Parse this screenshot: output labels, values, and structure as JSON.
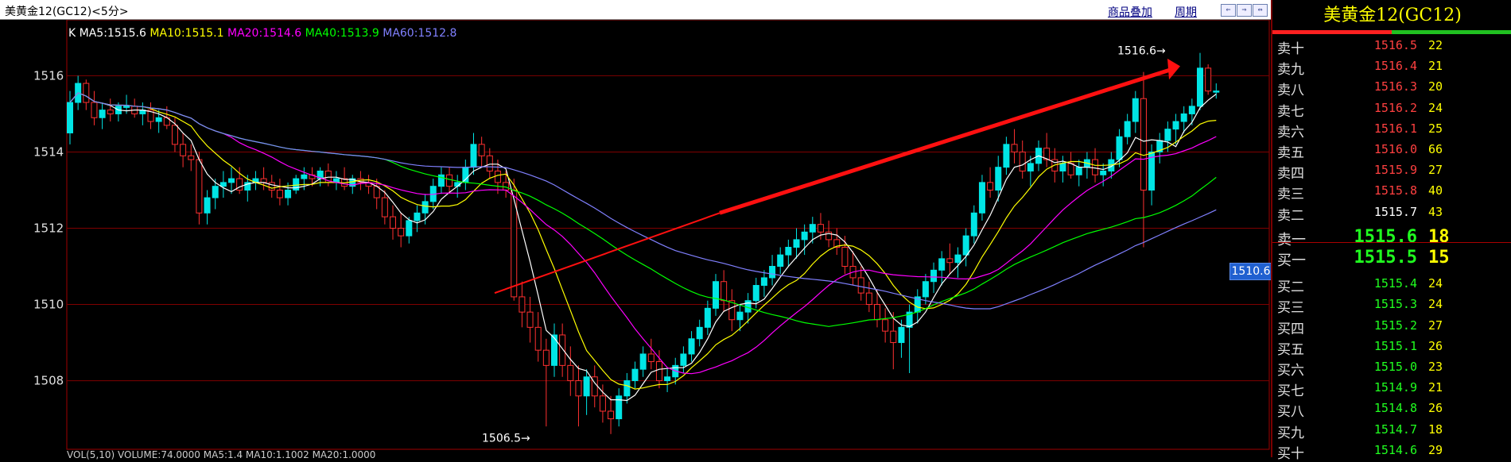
{
  "window": {
    "title": "美黄金12(GC12)<5分>",
    "overlay_link": "商品叠加",
    "period_link": "周期",
    "nav_buttons": [
      "⇐",
      "⇒",
      "⇔"
    ]
  },
  "indicator": {
    "prefix": "K",
    "items": [
      {
        "label": "MA5:1515.6",
        "color": "#ffffff"
      },
      {
        "label": "MA10:1515.1",
        "color": "#ffff00"
      },
      {
        "label": "MA20:1514.6",
        "color": "#ff00ff"
      },
      {
        "label": "MA40:1513.9",
        "color": "#00ff00"
      },
      {
        "label": "MA60:1512.8",
        "color": "#8080ff"
      }
    ]
  },
  "annotations": {
    "high_label": "1516.6",
    "low_label": "1506.5",
    "price_tag": "1510.6"
  },
  "bottom_indicator": "VOL(5,10) VOLUME:74.0000 MA5:1.4 MA10:1.1002 MA20:1.0000",
  "chart_data": {
    "type": "candlestick",
    "ylim": [
      1506.2,
      1517.3
    ],
    "y_ticks": [
      "1516",
      "1514",
      "1512",
      "1510",
      "1508"
    ],
    "candle_count": 142,
    "ohlc": [
      [
        1514.5,
        1515.6,
        1514.2,
        1515.3
      ],
      [
        1515.3,
        1516.0,
        1515.1,
        1515.8
      ],
      [
        1515.8,
        1515.9,
        1515.1,
        1515.3
      ],
      [
        1515.3,
        1515.6,
        1514.7,
        1514.9
      ],
      [
        1514.9,
        1515.3,
        1514.6,
        1515.1
      ],
      [
        1515.1,
        1515.4,
        1514.8,
        1515.0
      ],
      [
        1515.0,
        1515.3,
        1514.8,
        1515.2
      ],
      [
        1515.2,
        1515.5,
        1515.0,
        1515.2
      ],
      [
        1515.2,
        1515.4,
        1514.9,
        1515.0
      ],
      [
        1515.0,
        1515.3,
        1514.7,
        1515.1
      ],
      [
        1515.1,
        1515.3,
        1514.6,
        1514.8
      ],
      [
        1514.8,
        1515.1,
        1514.5,
        1514.9
      ],
      [
        1514.9,
        1515.2,
        1514.6,
        1514.7
      ],
      [
        1514.7,
        1514.9,
        1514.0,
        1514.2
      ],
      [
        1514.2,
        1514.5,
        1513.6,
        1513.9
      ],
      [
        1513.9,
        1514.2,
        1513.5,
        1513.8
      ],
      [
        1513.8,
        1514.0,
        1512.1,
        1512.4
      ],
      [
        1512.4,
        1513.0,
        1512.1,
        1512.8
      ],
      [
        1512.8,
        1513.3,
        1512.5,
        1513.1
      ],
      [
        1513.1,
        1513.5,
        1512.8,
        1513.2
      ],
      [
        1513.2,
        1513.6,
        1512.9,
        1513.3
      ],
      [
        1513.3,
        1513.6,
        1512.9,
        1513.0
      ],
      [
        1513.0,
        1513.4,
        1512.7,
        1513.2
      ],
      [
        1513.2,
        1513.5,
        1513.0,
        1513.3
      ],
      [
        1513.3,
        1513.6,
        1513.0,
        1513.2
      ],
      [
        1513.2,
        1513.4,
        1512.8,
        1513.0
      ],
      [
        1513.0,
        1513.3,
        1512.6,
        1512.8
      ],
      [
        1512.8,
        1513.2,
        1512.6,
        1513.0
      ],
      [
        1513.0,
        1513.4,
        1512.9,
        1513.3
      ],
      [
        1513.3,
        1513.6,
        1513.0,
        1513.4
      ],
      [
        1513.4,
        1513.6,
        1513.1,
        1513.3
      ],
      [
        1513.3,
        1513.6,
        1513.1,
        1513.5
      ],
      [
        1513.5,
        1513.7,
        1513.1,
        1513.2
      ],
      [
        1513.2,
        1513.5,
        1513.0,
        1513.3
      ],
      [
        1513.3,
        1513.6,
        1513.0,
        1513.1
      ],
      [
        1513.1,
        1513.4,
        1512.9,
        1513.3
      ],
      [
        1513.3,
        1513.5,
        1513.0,
        1513.2
      ],
      [
        1513.2,
        1513.4,
        1512.9,
        1513.1
      ],
      [
        1513.1,
        1513.3,
        1512.5,
        1512.8
      ],
      [
        1512.8,
        1513.0,
        1512.1,
        1512.3
      ],
      [
        1512.3,
        1512.6,
        1511.7,
        1512.0
      ],
      [
        1512.0,
        1512.4,
        1511.5,
        1511.8
      ],
      [
        1511.8,
        1512.3,
        1511.6,
        1512.2
      ],
      [
        1512.2,
        1512.6,
        1511.9,
        1512.4
      ],
      [
        1512.4,
        1512.9,
        1512.1,
        1512.7
      ],
      [
        1512.7,
        1513.3,
        1512.5,
        1513.1
      ],
      [
        1513.1,
        1513.6,
        1512.9,
        1513.4
      ],
      [
        1513.4,
        1513.6,
        1512.9,
        1513.1
      ],
      [
        1513.1,
        1513.4,
        1512.8,
        1513.2
      ],
      [
        1513.2,
        1513.8,
        1513.0,
        1513.6
      ],
      [
        1513.6,
        1514.5,
        1513.4,
        1514.2
      ],
      [
        1514.2,
        1514.4,
        1513.6,
        1513.9
      ],
      [
        1513.9,
        1514.1,
        1513.3,
        1513.5
      ],
      [
        1513.5,
        1513.8,
        1512.9,
        1513.2
      ],
      [
        1513.2,
        1513.5,
        1512.8,
        1513.0
      ],
      [
        1513.0,
        1513.3,
        1510.1,
        1510.2
      ],
      [
        1510.2,
        1510.6,
        1509.4,
        1509.8
      ],
      [
        1509.8,
        1510.2,
        1509.0,
        1509.4
      ],
      [
        1509.4,
        1509.8,
        1508.5,
        1508.8
      ],
      [
        1508.8,
        1509.1,
        1506.8,
        1508.4
      ],
      [
        1508.4,
        1509.5,
        1508.1,
        1509.2
      ],
      [
        1509.2,
        1509.5,
        1508.1,
        1508.4
      ],
      [
        1508.4,
        1508.9,
        1507.6,
        1508.0
      ],
      [
        1508.0,
        1508.4,
        1506.8,
        1507.6
      ],
      [
        1507.6,
        1508.3,
        1507.1,
        1508.1
      ],
      [
        1508.1,
        1508.4,
        1507.3,
        1507.6
      ],
      [
        1507.6,
        1507.9,
        1506.9,
        1507.2
      ],
      [
        1507.2,
        1507.6,
        1506.6,
        1507.0
      ],
      [
        1507.0,
        1507.8,
        1506.8,
        1507.6
      ],
      [
        1507.6,
        1508.2,
        1507.4,
        1508.0
      ],
      [
        1508.0,
        1508.5,
        1507.8,
        1508.3
      ],
      [
        1508.3,
        1508.9,
        1508.1,
        1508.7
      ],
      [
        1508.7,
        1509.1,
        1508.3,
        1508.5
      ],
      [
        1508.5,
        1508.8,
        1507.8,
        1508.0
      ],
      [
        1508.0,
        1508.3,
        1507.7,
        1508.1
      ],
      [
        1508.1,
        1508.6,
        1507.9,
        1508.4
      ],
      [
        1508.4,
        1508.9,
        1508.2,
        1508.7
      ],
      [
        1508.7,
        1509.3,
        1508.5,
        1509.1
      ],
      [
        1509.1,
        1509.6,
        1508.9,
        1509.4
      ],
      [
        1509.4,
        1510.1,
        1509.2,
        1509.9
      ],
      [
        1509.9,
        1510.8,
        1509.7,
        1510.6
      ],
      [
        1510.6,
        1510.9,
        1509.8,
        1510.1
      ],
      [
        1510.1,
        1510.4,
        1509.3,
        1509.6
      ],
      [
        1509.6,
        1510.0,
        1509.3,
        1509.8
      ],
      [
        1509.8,
        1510.3,
        1509.5,
        1510.1
      ],
      [
        1510.1,
        1510.7,
        1509.9,
        1510.5
      ],
      [
        1510.5,
        1510.9,
        1510.2,
        1510.7
      ],
      [
        1510.7,
        1511.3,
        1510.5,
        1511.0
      ],
      [
        1511.0,
        1511.5,
        1510.8,
        1511.3
      ],
      [
        1511.3,
        1511.7,
        1511.0,
        1511.5
      ],
      [
        1511.5,
        1512.0,
        1511.2,
        1511.7
      ],
      [
        1511.7,
        1512.1,
        1511.3,
        1511.9
      ],
      [
        1511.9,
        1512.3,
        1511.6,
        1512.1
      ],
      [
        1512.1,
        1512.4,
        1511.7,
        1511.9
      ],
      [
        1511.9,
        1512.2,
        1511.5,
        1511.7
      ],
      [
        1511.7,
        1512.0,
        1511.3,
        1511.5
      ],
      [
        1511.5,
        1511.8,
        1510.8,
        1511.0
      ],
      [
        1511.0,
        1511.4,
        1510.5,
        1510.7
      ],
      [
        1510.7,
        1511.0,
        1510.1,
        1510.3
      ],
      [
        1510.3,
        1510.6,
        1509.8,
        1510.0
      ],
      [
        1510.0,
        1510.4,
        1509.4,
        1509.6
      ],
      [
        1509.6,
        1509.9,
        1509.0,
        1509.3
      ],
      [
        1509.3,
        1509.8,
        1508.3,
        1509.0
      ],
      [
        1509.0,
        1509.6,
        1508.6,
        1509.4
      ],
      [
        1509.4,
        1510.0,
        1508.2,
        1509.8
      ],
      [
        1509.8,
        1510.4,
        1509.5,
        1510.2
      ],
      [
        1510.2,
        1510.8,
        1510.0,
        1510.6
      ],
      [
        1510.6,
        1511.1,
        1510.3,
        1510.9
      ],
      [
        1510.9,
        1511.4,
        1510.5,
        1511.2
      ],
      [
        1511.2,
        1511.6,
        1510.8,
        1511.1
      ],
      [
        1511.1,
        1511.5,
        1510.7,
        1511.3
      ],
      [
        1511.3,
        1512.0,
        1511.0,
        1511.8
      ],
      [
        1511.8,
        1512.6,
        1511.6,
        1512.4
      ],
      [
        1512.4,
        1513.4,
        1512.2,
        1513.2
      ],
      [
        1513.2,
        1513.6,
        1512.8,
        1513.0
      ],
      [
        1513.0,
        1513.9,
        1512.7,
        1513.6
      ],
      [
        1513.6,
        1514.4,
        1513.4,
        1514.2
      ],
      [
        1514.2,
        1514.6,
        1513.7,
        1514.0
      ],
      [
        1514.0,
        1514.3,
        1513.3,
        1513.5
      ],
      [
        1513.5,
        1513.9,
        1513.1,
        1513.7
      ],
      [
        1513.7,
        1514.3,
        1513.5,
        1514.1
      ],
      [
        1514.1,
        1514.5,
        1513.6,
        1513.8
      ],
      [
        1513.8,
        1514.1,
        1513.2,
        1513.5
      ],
      [
        1513.5,
        1513.9,
        1513.2,
        1513.7
      ],
      [
        1513.7,
        1514.0,
        1513.3,
        1513.4
      ],
      [
        1513.4,
        1513.8,
        1513.1,
        1513.6
      ],
      [
        1513.6,
        1514.0,
        1513.3,
        1513.8
      ],
      [
        1513.8,
        1514.1,
        1513.2,
        1513.4
      ],
      [
        1513.4,
        1513.7,
        1513.1,
        1513.5
      ],
      [
        1513.5,
        1514.0,
        1513.3,
        1513.8
      ],
      [
        1513.8,
        1514.6,
        1513.6,
        1514.4
      ],
      [
        1514.4,
        1515.0,
        1514.2,
        1514.8
      ],
      [
        1514.8,
        1515.6,
        1514.5,
        1515.4
      ],
      [
        1515.4,
        1516.1,
        1511.5,
        1513.0
      ],
      [
        1513.0,
        1514.2,
        1512.6,
        1514.0
      ],
      [
        1514.0,
        1514.5,
        1513.7,
        1514.3
      ],
      [
        1514.3,
        1514.8,
        1514.0,
        1514.6
      ],
      [
        1514.6,
        1515.0,
        1514.2,
        1514.8
      ],
      [
        1514.8,
        1515.2,
        1514.5,
        1515.0
      ],
      [
        1515.0,
        1515.4,
        1514.7,
        1515.2
      ],
      [
        1515.2,
        1516.6,
        1515.1,
        1516.2
      ],
      [
        1516.2,
        1516.3,
        1515.5,
        1515.6
      ],
      [
        1515.6,
        1515.8,
        1515.4,
        1515.6
      ]
    ]
  },
  "order_book": {
    "title": "美黄金12(GC12)",
    "asks": [
      {
        "label": "卖十",
        "price": "1516.5",
        "vol": "22"
      },
      {
        "label": "卖九",
        "price": "1516.4",
        "vol": "21"
      },
      {
        "label": "卖八",
        "price": "1516.3",
        "vol": "20"
      },
      {
        "label": "卖七",
        "price": "1516.2",
        "vol": "24"
      },
      {
        "label": "卖六",
        "price": "1516.1",
        "vol": "25"
      },
      {
        "label": "卖五",
        "price": "1516.0",
        "vol": "66"
      },
      {
        "label": "卖四",
        "price": "1515.9",
        "vol": "27"
      },
      {
        "label": "卖三",
        "price": "1515.8",
        "vol": "40"
      },
      {
        "label": "卖二",
        "price": "1515.7",
        "vol": "43"
      },
      {
        "label": "卖一",
        "price": "1515.6",
        "vol": "18"
      }
    ],
    "bids": [
      {
        "label": "买一",
        "price": "1515.5",
        "vol": "15"
      },
      {
        "label": "买二",
        "price": "1515.4",
        "vol": "24"
      },
      {
        "label": "买三",
        "price": "1515.3",
        "vol": "24"
      },
      {
        "label": "买四",
        "price": "1515.2",
        "vol": "27"
      },
      {
        "label": "买五",
        "price": "1515.1",
        "vol": "26"
      },
      {
        "label": "买六",
        "price": "1515.0",
        "vol": "23"
      },
      {
        "label": "买七",
        "price": "1514.9",
        "vol": "21"
      },
      {
        "label": "买八",
        "price": "1514.8",
        "vol": "26"
      },
      {
        "label": "买九",
        "price": "1514.7",
        "vol": "18"
      },
      {
        "label": "买十",
        "price": "1514.6",
        "vol": "29"
      }
    ],
    "colors": {
      "ask": "#ff4040",
      "ask_last": "#ffffff",
      "ask_best": "#20ff20",
      "bid": "#20ff20",
      "vol": "#ffff00"
    }
  },
  "colors": {
    "up": "#00e5e5",
    "down": "#ff3030",
    "grid": "#800000",
    "axis_text": "#e0e0e0",
    "trendline": "#ff1010"
  }
}
